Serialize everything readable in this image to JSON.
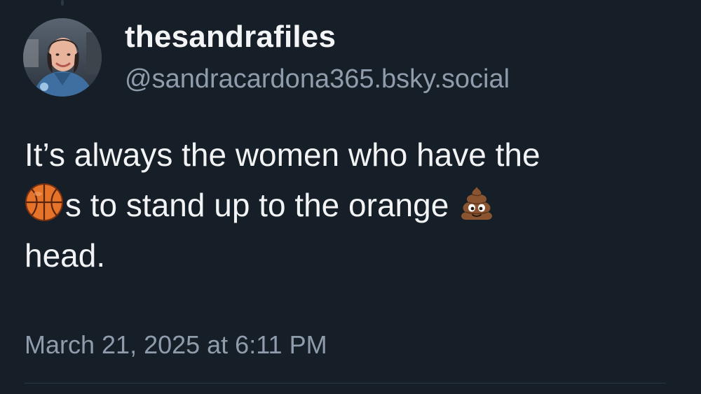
{
  "post": {
    "author": {
      "display_name": "thesandrafiles",
      "handle": "@sandracardona365.bsky.social",
      "avatar_icon": "avatar-photo"
    },
    "text": {
      "line1": "It’s always the women who have the",
      "line2_after_ball": "s to stand up to the orange",
      "line3": "head.",
      "emojis": [
        "basketball-icon",
        "pile-of-poo-icon"
      ]
    },
    "timestamp": "March 21, 2025 at 6:11 PM"
  },
  "colors": {
    "background": "#161e27",
    "primary_text": "#f1f3f5",
    "secondary_text": "#8f9cab",
    "divider": "#2c3744"
  }
}
